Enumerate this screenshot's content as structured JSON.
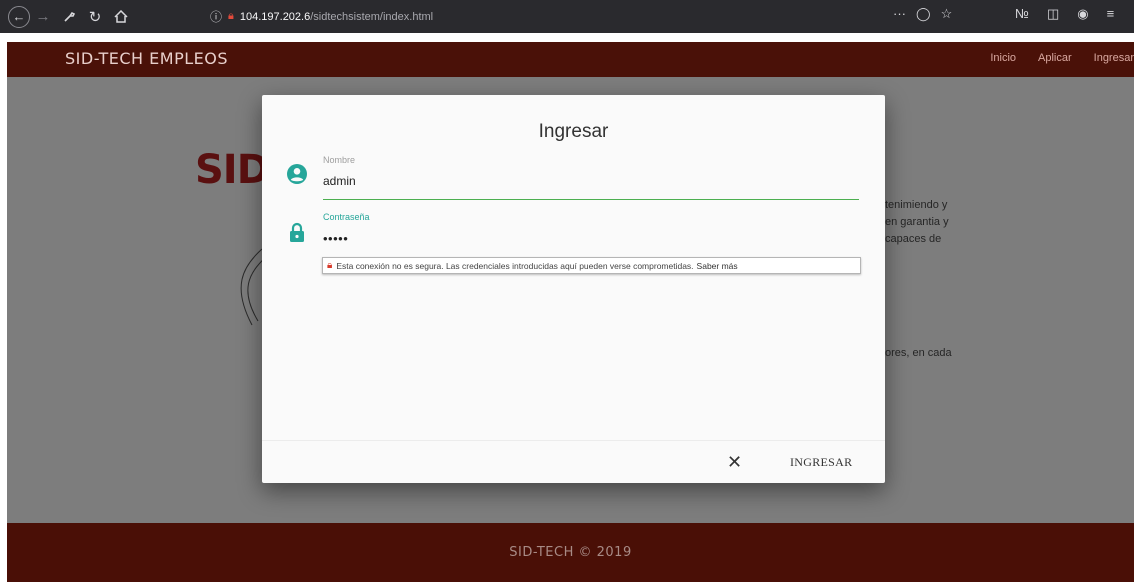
{
  "browser": {
    "url_host": "104.197.202.6",
    "url_path": "/sidtechsistem/index.html",
    "menu_dots": "···"
  },
  "site": {
    "brand": "SID-TECH EMPLEOS",
    "nav_links": [
      "Inicio",
      "Aplicar",
      "Ingresar"
    ],
    "bg_logo": "SID.",
    "bg_text_lines_1": [
      "tenimiendo y",
      "en garantia y",
      "capaces de"
    ],
    "bg_text_lines_2": [
      "ores, en cada"
    ],
    "footer": "SID-TECH © 2019"
  },
  "modal": {
    "title": "Ingresar",
    "username": {
      "label": "Nombre",
      "value": "admin",
      "icon": "account-circle-icon"
    },
    "password": {
      "label": "Contraseña",
      "value": "•••••",
      "icon": "lock-icon"
    },
    "insecure_warning": {
      "text": "Esta conexión no es segura. Las credenciales introducidas aquí pueden verse comprometidas.",
      "link": "Saber más",
      "icon": "insecure-lock-icon"
    },
    "close_label": "✕",
    "submit_label": "INGRESAR"
  },
  "colors": {
    "accent": "#26a69a",
    "field_line": "#4caf50",
    "navbar": "#4a1108",
    "footer": "#4a0f06"
  }
}
